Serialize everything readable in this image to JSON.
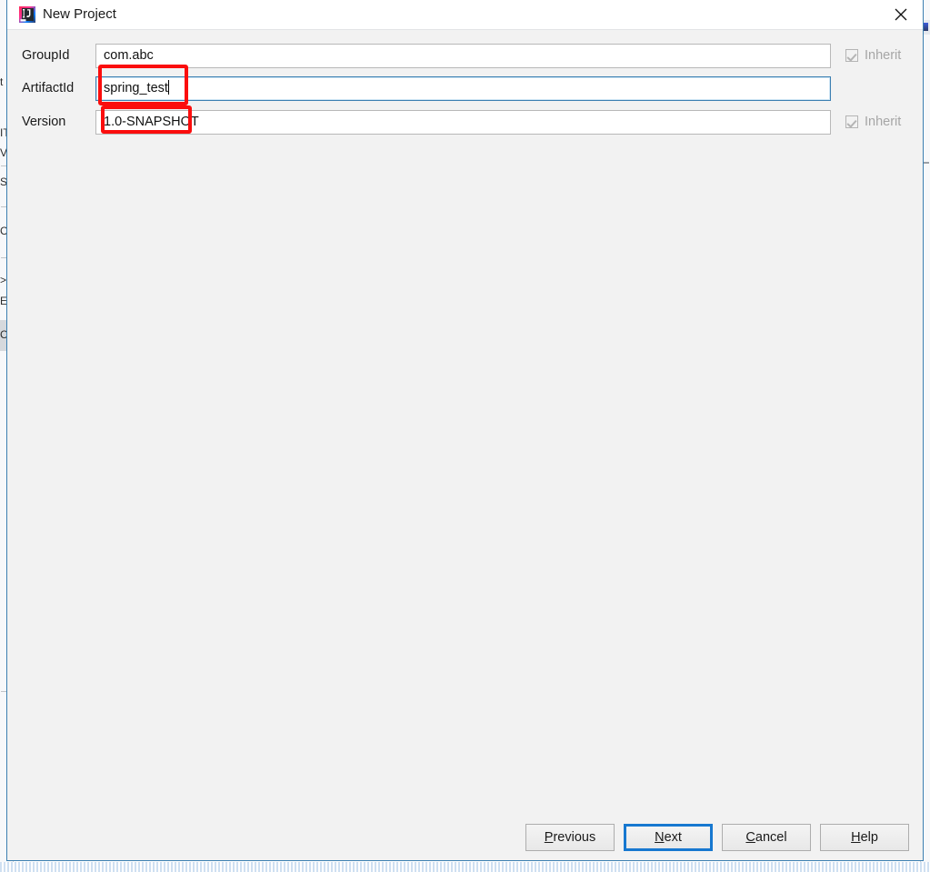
{
  "window": {
    "title": "New Project",
    "app_icon": "intellij-idea-icon",
    "close_icon": "close-icon"
  },
  "form": {
    "rows": [
      {
        "label": "GroupId",
        "value": "com.abc",
        "placeholder": "",
        "focused": false,
        "has_inherit": true,
        "inherit_label": "Inherit",
        "inherit_checked": true,
        "inherit_disabled": true,
        "annotated": true
      },
      {
        "label": "ArtifactId",
        "value": "spring_test",
        "placeholder": "",
        "focused": true,
        "has_inherit": false,
        "inherit_label": "",
        "inherit_checked": false,
        "inherit_disabled": false,
        "annotated": true
      },
      {
        "label": "Version",
        "value": "1.0-SNAPSHOT",
        "placeholder": "",
        "focused": false,
        "has_inherit": true,
        "inherit_label": "Inherit",
        "inherit_checked": true,
        "inherit_disabled": true,
        "annotated": false
      }
    ]
  },
  "buttons": {
    "previous": {
      "label": "Previous",
      "mnemonic": "P",
      "rest": "revious",
      "focused": false
    },
    "next": {
      "label": "Next",
      "mnemonic": "N",
      "rest": "ext",
      "focused": true
    },
    "cancel": {
      "label": "Cancel",
      "mnemonic": "C",
      "rest": "ancel",
      "focused": false
    },
    "help": {
      "label": "Help",
      "mnemonic": "H",
      "rest": "elp",
      "focused": false
    }
  },
  "annotations": {
    "color": "#fb0d0d",
    "targets": [
      "GroupId field",
      "ArtifactId field"
    ]
  },
  "colors": {
    "dialog_background": "#f2f2f2",
    "titlebar_background": "#ffffff",
    "input_background": "#ffffff",
    "focus_blue": "#1778d0",
    "field_border": "#b8b8b8",
    "disabled_text": "#a6a6a6",
    "annotation_red": "#fb0d0d"
  },
  "background_ide": {
    "left_fragments": [
      "t",
      "IT",
      "V",
      "S",
      "C",
      ">",
      "E",
      "C"
    ],
    "right_icon": "tool-window-icon"
  }
}
